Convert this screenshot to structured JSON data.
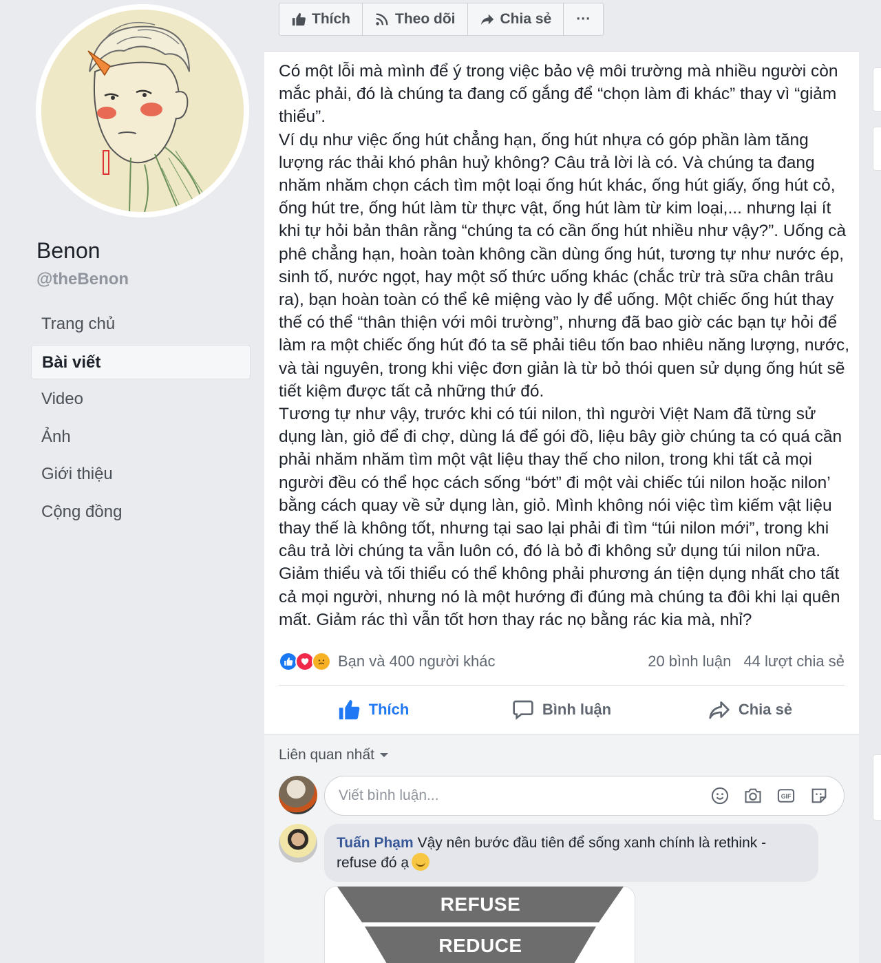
{
  "page": {
    "name": "Benon",
    "handle": "@theBenon"
  },
  "nav": {
    "items": [
      {
        "label": "Trang chủ"
      },
      {
        "label": "Bài viết"
      },
      {
        "label": "Video"
      },
      {
        "label": "Ảnh"
      },
      {
        "label": "Giới thiệu"
      },
      {
        "label": "Cộng đồng"
      }
    ],
    "active_index": 1
  },
  "topbar": {
    "like_label": "Thích",
    "follow_label": "Theo dõi",
    "share_label": "Chia sẻ",
    "more_label": "···"
  },
  "post": {
    "text": "Có một lỗi mà mình để ý trong việc bảo vệ môi trường mà nhiều người còn mắc phải, đó là chúng ta đang cố gắng để “chọn làm đi khác” thay vì “giảm thiểu”.\nVí dụ như việc ống hút chẳng hạn, ống hút nhựa có góp phần làm tăng lượng rác thải khó phân huỷ không? Câu trả lời là có. Và chúng ta đang nhăm nhăm chọn cách tìm một loại ống hút khác, ống hút giấy, ống hút cỏ, ống hút tre, ống hút làm từ thực vật, ống hút làm từ kim loại,... nhưng lại ít khi tự hỏi bản thân rằng “chúng ta có cần ống hút nhiều như vậy?”. Uống cà phê chẳng hạn, hoàn toàn không cần dùng ống hút, tương tự như nước ép, sinh tố, nước ngọt, hay một số thức uống khác (chắc trừ trà sữa chân trâu ra), bạn hoàn toàn có thể kê miệng vào ly để uống. Một chiếc ống hút thay thế có thể “thân thiện với môi trường”, nhưng đã bao giờ các bạn tự hỏi để làm ra một chiếc ống hút đó ta sẽ phải tiêu tốn bao nhiêu năng lượng, nước, và tài nguyên, trong khi việc đơn giản là từ bỏ thói quen sử dụng ống hút sẽ tiết kiệm được tất cả những thứ đó.\nTương tự như vậy, trước khi có túi nilon, thì người Việt Nam đã từng sử dụng làn, giỏ để đi chợ, dùng lá để gói đồ, liệu bây giờ chúng ta có quá cần phải nhăm nhăm tìm một vật liệu thay thế cho nilon, trong khi tất cả mọi người đều có thể học cách sống “bớt” đi một vài chiếc túi nilon hoặc nilon’ bằng cách quay về sử dụng làn, giỏ. Mình không nói việc tìm kiếm vật liệu thay thế là không tốt, nhưng tại sao lại phải đi tìm “túi nilon mới”, trong khi câu trả lời chúng ta vẫn luôn có, đó là bỏ đi không sử dụng túi nilon nữa.\nGiảm thiểu và tối thiểu có thể không phải phương án tiện dụng nhất cho tất cả mọi người, nhưng nó là một hướng đi đúng mà chúng ta đôi khi lại quên mất. Giảm rác thì vẫn tốt hơn thay rác nọ bằng rác kia mà, nhỉ?",
    "reactions_text": "Bạn và 400 người khác",
    "comments_count": "20 bình luận",
    "shares_count": "44 lượt chia sẻ",
    "reaction_icons": [
      "like-icon",
      "love-icon",
      "sad-icon"
    ],
    "actions": {
      "like": "Thích",
      "comment": "Bình luận",
      "share": "Chia sẻ"
    }
  },
  "comments": {
    "sort_label": "Liên quan nhất",
    "input_placeholder": "Viết bình luận...",
    "items": [
      {
        "author": "Tuấn Phạm",
        "text": "Vậy nên bước đầu tiên để sống xanh chính là rethink - refuse đó ạ",
        "image_labels": [
          "REFUSE",
          "REDUCE"
        ]
      }
    ]
  },
  "colors": {
    "link_blue": "#385898",
    "liked_blue": "#2078f4",
    "page_bg": "#e9ebee",
    "funnel_gray": "#6d6d6d"
  }
}
